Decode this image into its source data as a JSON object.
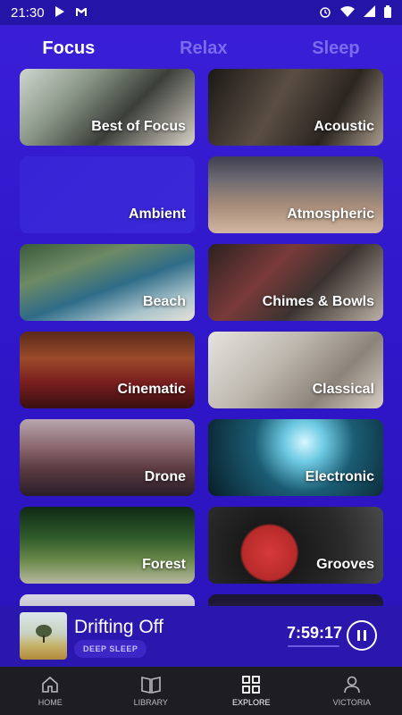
{
  "status_bar": {
    "time": "21:30"
  },
  "tabs": [
    {
      "label": "Focus",
      "active": true
    },
    {
      "label": "Relax",
      "active": false
    },
    {
      "label": "Sleep",
      "active": false
    }
  ],
  "categories": [
    {
      "label": "Best of Focus"
    },
    {
      "label": "Acoustic"
    },
    {
      "label": "Ambient"
    },
    {
      "label": "Atmospheric"
    },
    {
      "label": "Beach"
    },
    {
      "label": "Chimes & Bowls"
    },
    {
      "label": "Cinematic"
    },
    {
      "label": "Classical"
    },
    {
      "label": "Drone"
    },
    {
      "label": "Electronic"
    },
    {
      "label": "Forest"
    },
    {
      "label": "Grooves"
    }
  ],
  "player": {
    "title": "Drifting Off",
    "badge": "DEEP SLEEP",
    "timer": "7:59:17"
  },
  "nav": [
    {
      "label": "HOME"
    },
    {
      "label": "LIBRARY"
    },
    {
      "label": "EXPLORE"
    },
    {
      "label": "VICTORIA"
    }
  ],
  "colors": {
    "accent": "#3a1fd6",
    "tab_inactive": "#7a6cf0",
    "nav_bg": "#1e1e22"
  }
}
